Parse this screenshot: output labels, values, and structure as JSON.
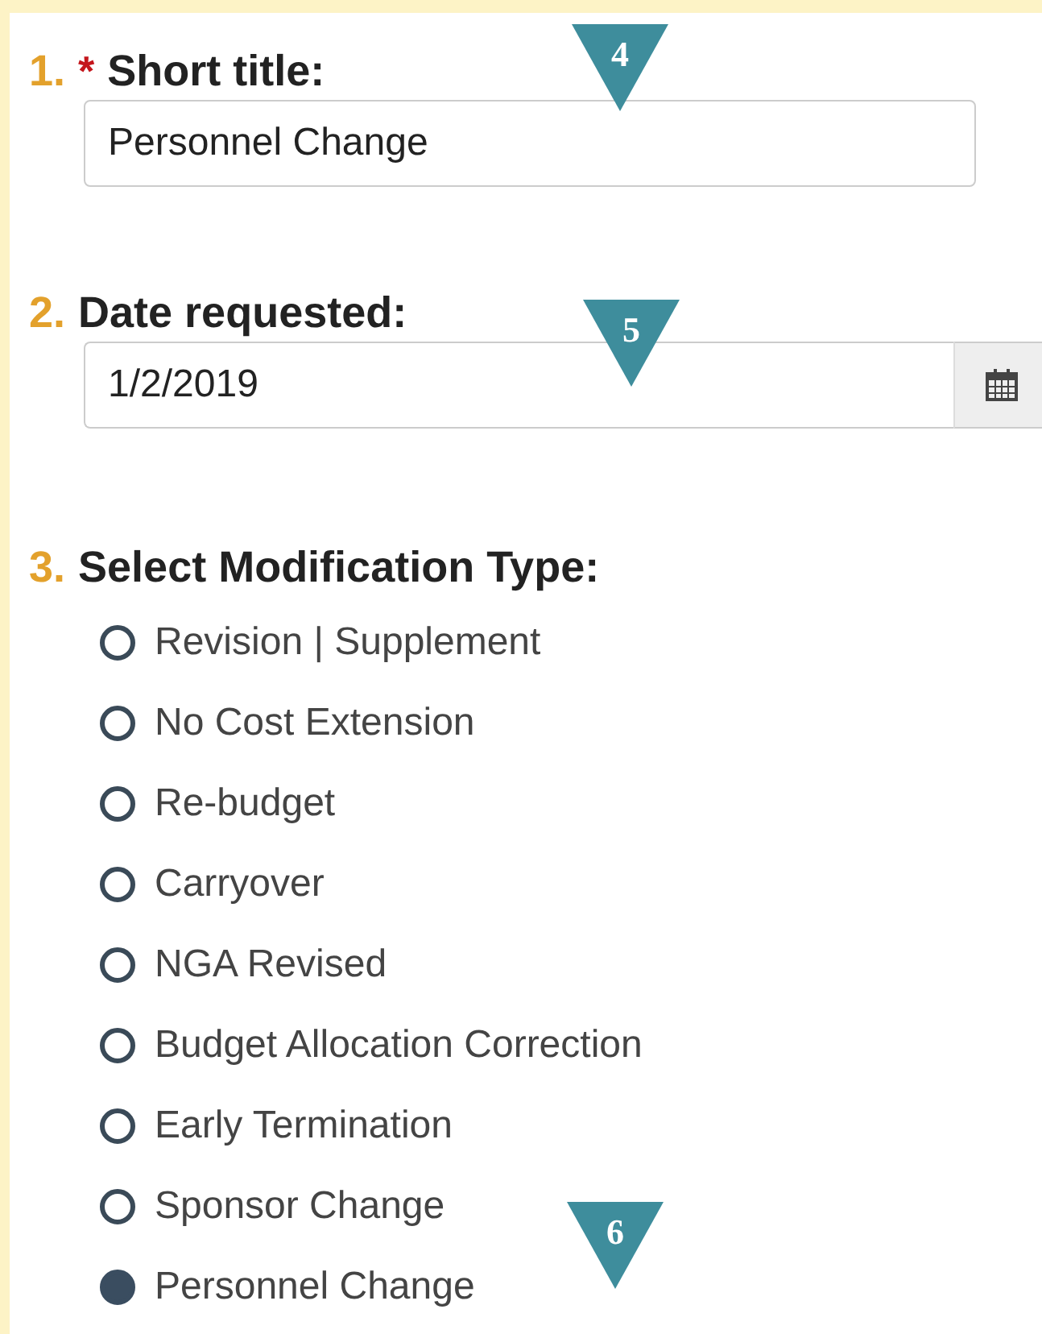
{
  "questions": [
    {
      "number": "1.",
      "required_mark": "*",
      "label": "Short title:",
      "kind": "text",
      "value": "Personnel Change"
    },
    {
      "number": "2.",
      "label": "Date requested:",
      "kind": "date",
      "value": "1/2/2019"
    },
    {
      "number": "3.",
      "label": "Select Modification Type:",
      "kind": "radio",
      "options": [
        {
          "label": "Revision | Supplement",
          "selected": false
        },
        {
          "label": "No Cost Extension",
          "selected": false
        },
        {
          "label": "Re-budget",
          "selected": false
        },
        {
          "label": "Carryover",
          "selected": false
        },
        {
          "label": "NGA Revised",
          "selected": false
        },
        {
          "label": "Budget Allocation Correction",
          "selected": false
        },
        {
          "label": "Early Termination",
          "selected": false
        },
        {
          "label": "Sponsor Change",
          "selected": false
        },
        {
          "label": "Personnel Change",
          "selected": true
        }
      ]
    }
  ],
  "markers": [
    {
      "label": "4"
    },
    {
      "label": "5"
    },
    {
      "label": "6"
    }
  ]
}
